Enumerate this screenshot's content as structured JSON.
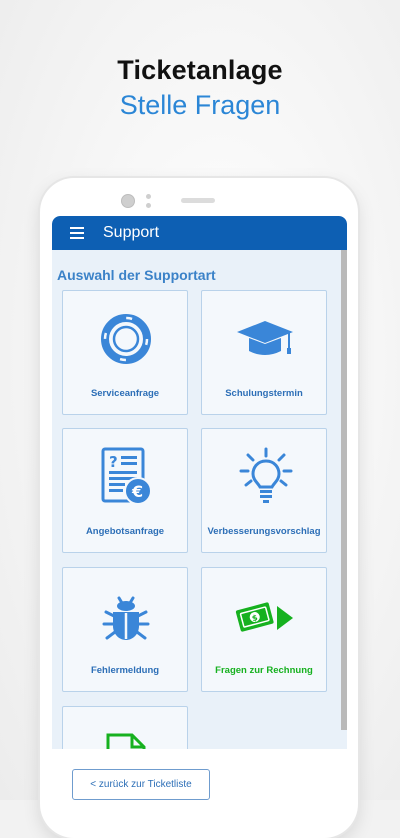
{
  "promo": {
    "title": "Ticketanlage",
    "subtitle": "Stelle Fragen"
  },
  "appbar": {
    "title": "Support",
    "menu_icon": "hamburger-menu-icon"
  },
  "section": {
    "title": "Auswahl der Supportart"
  },
  "tiles": [
    {
      "label": "Serviceanfrage",
      "icon": "lifebuoy-icon",
      "color": "#3a86d8"
    },
    {
      "label": "Schulungstermin",
      "icon": "graduation-cap-icon",
      "color": "#3a86d8"
    },
    {
      "label": "Angebotsanfrage",
      "icon": "quote-document-euro-icon",
      "color": "#3a86d8"
    },
    {
      "label": "Verbesserungsvorschlag",
      "icon": "lightbulb-icon",
      "color": "#3a86d8"
    },
    {
      "label": "Fehlermeldung",
      "icon": "bug-icon",
      "color": "#3a86d8"
    },
    {
      "label": "Fragen zur Rechnung",
      "icon": "money-arrow-icon",
      "color": "#16b11f"
    },
    {
      "label": "",
      "icon": "document-icon",
      "color": "#16b11f"
    }
  ],
  "footer": {
    "back_label": "< zurück zur Ticketliste"
  },
  "colors": {
    "primary": "#0d5fb3",
    "accent_blue": "#3a86d8",
    "accent_green": "#16b11f"
  }
}
